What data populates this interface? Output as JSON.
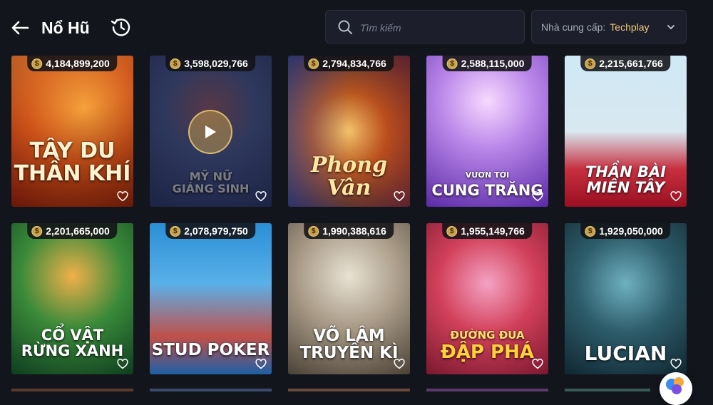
{
  "header": {
    "title": "Nổ Hũ"
  },
  "search": {
    "placeholder": "Tìm kiếm"
  },
  "provider": {
    "label": "Nhà cung cấp:",
    "value": "Techplay"
  },
  "colors": {
    "background": "#13151d",
    "accent": "#f0c97a",
    "panel": "#1c1f2b"
  },
  "games": [
    {
      "name": "TÂY DU\nTHẦN KHÍ",
      "jackpot": "4,184,899,200"
    },
    {
      "name": "MỸ NỮ\nGIÁNG SINH",
      "jackpot": "3,598,029,766"
    },
    {
      "name": "Phong Vân",
      "jackpot": "2,794,834,766"
    },
    {
      "name": "CUNG TRĂNG",
      "subtitle": "VƯƠN TỚI",
      "jackpot": "2,588,115,000"
    },
    {
      "name": "THẦN BÀI\nMIỀN TÂY",
      "jackpot": "2,215,661,766"
    },
    {
      "name": "CỔ VẬT\nRỪNG XANH",
      "jackpot": "2,201,665,000"
    },
    {
      "name": "STUD POKER",
      "jackpot": "2,078,979,750"
    },
    {
      "name": "VÕ LÂM\nTRUYỀN KÌ",
      "jackpot": "1,990,388,616"
    },
    {
      "name": "ĐẬP PHÁ",
      "subtitle": "ĐƯỜNG ĐUA",
      "jackpot": "1,955,149,766"
    },
    {
      "name": "LUCIAN",
      "jackpot": "1,929,050,000"
    }
  ]
}
